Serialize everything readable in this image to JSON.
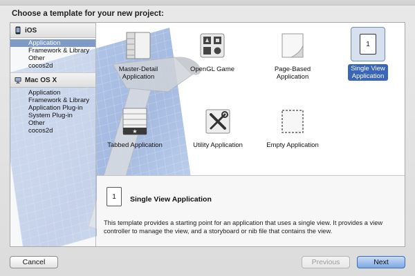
{
  "heading": "Choose a template for your new project:",
  "sidebar": {
    "groups": [
      {
        "label": "iOS",
        "icon": "iphone-icon",
        "items": [
          "Application",
          "Framework & Library",
          "Other",
          "cocos2d"
        ]
      },
      {
        "label": "Mac OS X",
        "icon": "monitor-icon",
        "items": [
          "Application",
          "Framework & Library",
          "Application Plug-in",
          "System Plug-in",
          "Other",
          "cocos2d"
        ]
      }
    ],
    "selected": "iOS / Application"
  },
  "templates": [
    {
      "label_line1": "Master-Detail",
      "label_line2": "Application",
      "icon": "master-detail-icon"
    },
    {
      "label_line1": "OpenGL Game",
      "label_line2": "",
      "icon": "opengl-game-icon"
    },
    {
      "label_line1": "Page-Based",
      "label_line2": "Application",
      "icon": "page-based-icon"
    },
    {
      "label_line1": "Single View",
      "label_line2": "Application",
      "icon": "single-view-icon"
    },
    {
      "label_line1": "Tabbed Application",
      "label_line2": "",
      "icon": "tabbed-icon"
    },
    {
      "label_line1": "Utility Application",
      "label_line2": "",
      "icon": "utility-icon"
    },
    {
      "label_line1": "Empty Application",
      "label_line2": "",
      "icon": "empty-application-icon"
    }
  ],
  "selected_template": "Single View Application",
  "detail": {
    "icon_text": "1",
    "title": "Single View Application",
    "description": "This template provides a starting point for an application that uses a single view. It provides a view controller to manage the view, and a storyboard or nib file that contains the view."
  },
  "single_view_icon_text": "1",
  "buttons": {
    "cancel": "Cancel",
    "previous": "Previous",
    "next": "Next"
  },
  "colors": {
    "selection": "#7f9ac7",
    "selected_label": "#3a66b8",
    "next_button": "#7ea8e4"
  }
}
